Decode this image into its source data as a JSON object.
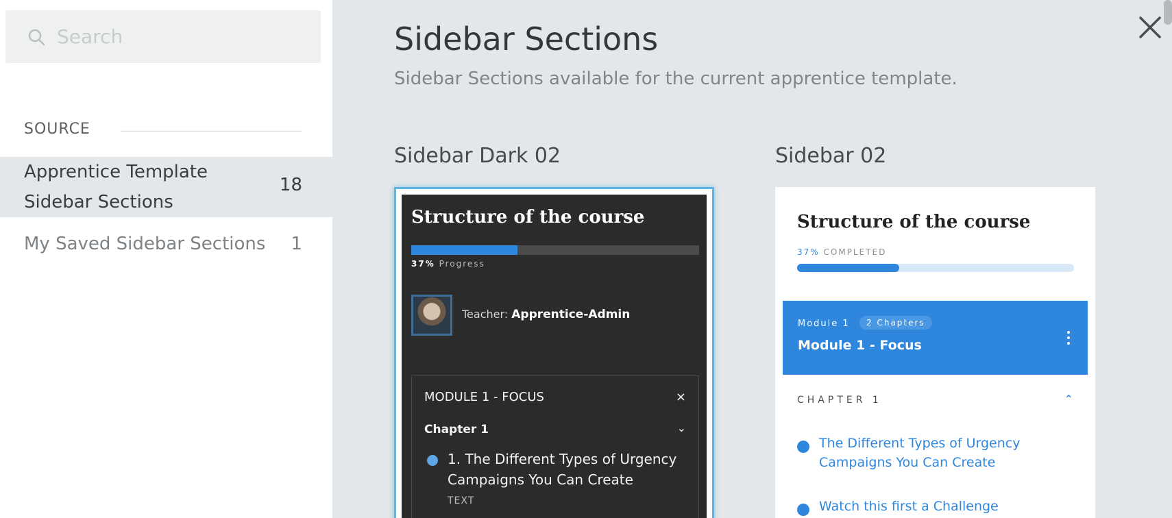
{
  "search": {
    "placeholder": "Search"
  },
  "sources": {
    "header": "SOURCE",
    "items": [
      {
        "label_line1": "Apprentice Template",
        "label_line2": "Sidebar Sections",
        "count": "18",
        "active": true
      },
      {
        "label": "My Saved Sidebar Sections",
        "count": "1",
        "active": false
      }
    ]
  },
  "main": {
    "title": "Sidebar Sections",
    "subtitle": "Sidebar Sections available for the current apprentice template."
  },
  "cards": [
    {
      "label": "Sidebar Dark 02",
      "preview": {
        "title": "Structure of the course",
        "progress_percent": "37%",
        "progress_value": 0.37,
        "progress_label": "Progress",
        "teacher_prefix": "Teacher:",
        "teacher_name": "Apprentice-Admin",
        "module_title": "MODULE 1 - FOCUS",
        "close_glyph": "×",
        "chapter": "Chapter 1",
        "chevron": "⌄",
        "lesson": "1. The Different Types of Urgency Campaigns You Can Create",
        "lesson_type": "TEXT"
      }
    },
    {
      "label": "Sidebar 02",
      "preview": {
        "title": "Structure of the course",
        "progress_percent": "37%",
        "progress_value": 0.37,
        "progress_label": "COMPLETED",
        "module_small": "Module 1",
        "module_badge": "2 Chapters",
        "module_name": "Module 1 - Focus",
        "chapter": "CHAPTER 1",
        "chevron": "⌃",
        "lessons": [
          "The Different Types of Urgency Campaigns You Can Create",
          "Watch this first a Challenge"
        ]
      }
    }
  ],
  "colors": {
    "accent": "#2f86dd",
    "selected_border": "#5bb6e6",
    "dark_bg": "#2b2b2b"
  },
  "icons": {
    "search": "search-icon",
    "close": "close-icon",
    "check": "check-circle-icon",
    "kebab": "kebab-icon"
  }
}
